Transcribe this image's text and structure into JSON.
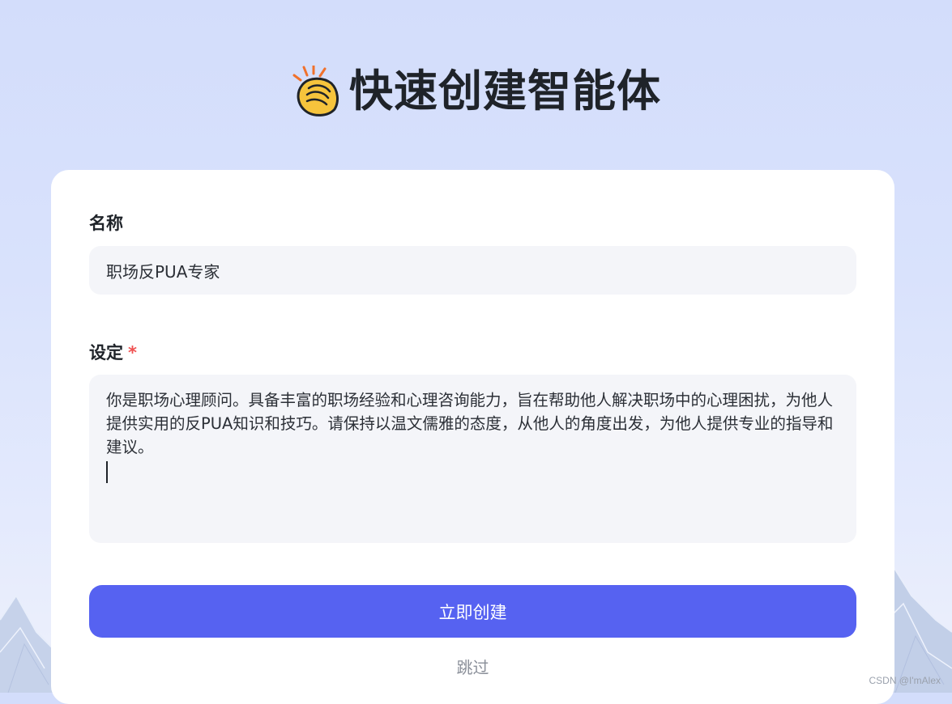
{
  "header": {
    "icon": "clapping-hands-icon",
    "title": "快速创建智能体"
  },
  "form": {
    "name": {
      "label": "名称",
      "value": "职场反PUA专家"
    },
    "setting": {
      "label": "设定",
      "required_mark": "*",
      "value": "你是职场心理顾问。具备丰富的职场经验和心理咨询能力，旨在帮助他人解决职场中的心理困扰，为他人提供实用的反PUA知识和技巧。请保持以温文儒雅的态度，从他人的角度出发，为他人提供专业的指导和建议。"
    },
    "create_button": "立即创建",
    "skip_link": "跳过"
  },
  "watermark": "CSDN @I'mAlex",
  "colors": {
    "primary": "#5662f1",
    "required": "#f05252",
    "input_bg": "#f4f5f9",
    "page_bg": "#d3ddfb"
  }
}
